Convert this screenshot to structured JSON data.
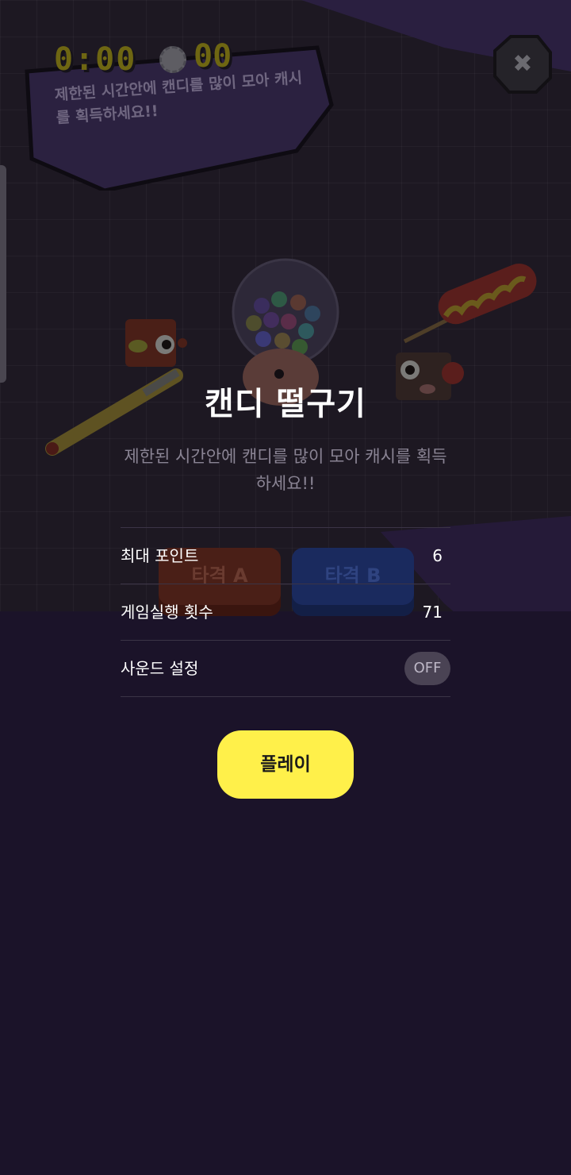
{
  "game_scene": {
    "timer": "0:00",
    "score": "00",
    "hud_description": "제한된 시간안에 캔디를 많이 모아 캐시를 획득하세요!!",
    "close_icon": "close-icon",
    "hit_a_label": "타격 A",
    "hit_b_label": "타격 B"
  },
  "modal": {
    "title": "캔디 떨구기",
    "description": "제한된 시간안에 캔디를 많이 모아 캐시를 획득하세요!!",
    "stats": [
      {
        "label": "최대 포인트",
        "value": "6"
      },
      {
        "label": "게임실행 횟수",
        "value": "71"
      }
    ],
    "sound": {
      "label": "사운드 설정",
      "toggle": "OFF"
    },
    "play_label": "플레이"
  },
  "colors": {
    "background": "#1a1228",
    "play_button": "#fff04a",
    "toggle_off": "#4a4354",
    "text_primary": "#ffffff",
    "text_secondary": "#8a8494"
  }
}
